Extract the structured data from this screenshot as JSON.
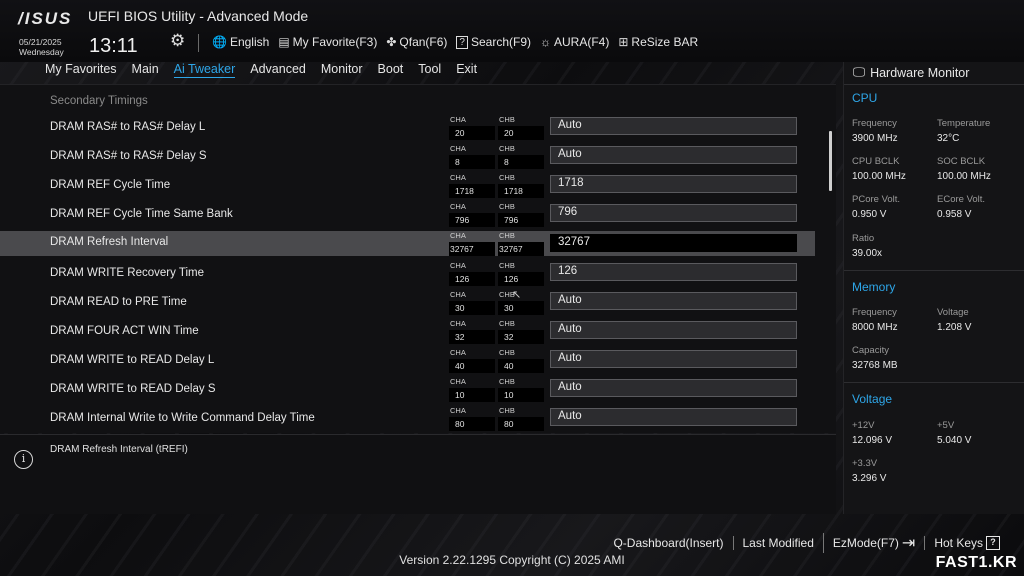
{
  "header": {
    "logo": "/ISUS",
    "title": "UEFI BIOS Utility - Advanced Mode",
    "date": "05/21/2025",
    "weekday": "Wednesday",
    "time": "13:11",
    "tools": [
      {
        "icon": "globe-icon",
        "glyph": "🌐",
        "label": "English"
      },
      {
        "icon": "favorite-icon",
        "glyph": "▤",
        "label": "My Favorite(F3)"
      },
      {
        "icon": "fan-icon",
        "glyph": "✤",
        "label": "Qfan(F6)"
      },
      {
        "icon": "search-icon",
        "glyph": "?",
        "label": "Search(F9)"
      },
      {
        "icon": "aura-icon",
        "glyph": "☼",
        "label": "AURA(F4)"
      },
      {
        "icon": "resize-bar-icon",
        "glyph": "⊞",
        "label": "ReSize BAR"
      }
    ]
  },
  "nav": [
    "My Favorites",
    "Main",
    "Ai Tweaker",
    "Advanced",
    "Monitor",
    "Boot",
    "Tool",
    "Exit"
  ],
  "nav_active": "Ai Tweaker",
  "main": {
    "section": "Secondary Timings",
    "rows": [
      {
        "label": "DRAM RAS# to RAS# Delay L",
        "cha_tag": "CHA",
        "chb_tag": "CHB",
        "cha": "20",
        "chb": "20",
        "value": "Auto"
      },
      {
        "label": "DRAM RAS# to RAS# Delay S",
        "cha_tag": "CHA",
        "chb_tag": "CHB",
        "cha": "8",
        "chb": "8",
        "value": "Auto"
      },
      {
        "label": "DRAM REF Cycle Time",
        "cha_tag": "CHA",
        "chb_tag": "CHB",
        "cha": "1718",
        "chb": "1718",
        "value": "1718"
      },
      {
        "label": "DRAM REF Cycle Time Same Bank",
        "cha_tag": "CHA",
        "chb_tag": "CHB",
        "cha": "796",
        "chb": "796",
        "value": "796"
      },
      {
        "label": "DRAM Refresh Interval",
        "cha_tag": "CHA",
        "chb_tag": "CHB",
        "cha": "32767",
        "chb": "32767",
        "value": "32767"
      },
      {
        "label": "DRAM WRITE Recovery Time",
        "cha_tag": "CHA",
        "chb_tag": "CHB",
        "cha": "126",
        "chb": "126",
        "value": "126"
      },
      {
        "label": "DRAM READ to PRE Time",
        "cha_tag": "CHA",
        "chb_tag": "CHB",
        "cha": "30",
        "chb": "30",
        "value": "Auto"
      },
      {
        "label": "DRAM FOUR ACT WIN Time",
        "cha_tag": "CHA",
        "chb_tag": "CHB",
        "cha": "32",
        "chb": "32",
        "value": "Auto"
      },
      {
        "label": "DRAM WRITE to READ Delay L",
        "cha_tag": "CHA",
        "chb_tag": "CHB",
        "cha": "40",
        "chb": "40",
        "value": "Auto"
      },
      {
        "label": "DRAM WRITE to READ Delay S",
        "cha_tag": "CHA",
        "chb_tag": "CHB",
        "cha": "10",
        "chb": "10",
        "value": "Auto"
      },
      {
        "label": "DRAM Internal Write to Write Command Delay Time",
        "cha_tag": "CHA",
        "chb_tag": "CHB",
        "cha": "80",
        "chb": "80",
        "value": "Auto"
      }
    ],
    "selected_row": "DRAM Refresh Interval"
  },
  "help": {
    "text": "DRAM Refresh Interval (tREFI)"
  },
  "hardware_monitor": {
    "title": "Hardware Monitor",
    "cpu": {
      "heading": "CPU",
      "items": [
        {
          "k": "Frequency",
          "v": "3900 MHz"
        },
        {
          "k": "Temperature",
          "v": "32°C"
        },
        {
          "k": "CPU BCLK",
          "v": "100.00 MHz"
        },
        {
          "k": "SOC BCLK",
          "v": "100.00 MHz"
        },
        {
          "k": "PCore Volt.",
          "v": "0.950 V"
        },
        {
          "k": "ECore Volt.",
          "v": "0.958 V"
        },
        {
          "k": "Ratio",
          "v": "39.00x"
        }
      ]
    },
    "memory": {
      "heading": "Memory",
      "items": [
        {
          "k": "Frequency",
          "v": "8000 MHz"
        },
        {
          "k": "Voltage",
          "v": "1.208 V"
        },
        {
          "k": "Capacity",
          "v": "32768 MB"
        }
      ]
    },
    "voltage": {
      "heading": "Voltage",
      "items": [
        {
          "k": "+12V",
          "v": "12.096 V"
        },
        {
          "k": "+5V",
          "v": "5.040 V"
        },
        {
          "k": "+3.3V",
          "v": "3.296 V"
        }
      ]
    }
  },
  "footer": {
    "actions": [
      "Q-Dashboard(Insert)",
      "Last Modified",
      "EzMode(F7)",
      "Hot Keys"
    ],
    "ezmode_glyph": "⇥",
    "hotkeys_glyph": "?",
    "version": "Version 2.22.1295 Copyright (C) 2025 AMI",
    "watermark": "FAST1.KR"
  },
  "colors": {
    "accent": "#2ea6e8",
    "selected_row": "#4a4a4d"
  }
}
